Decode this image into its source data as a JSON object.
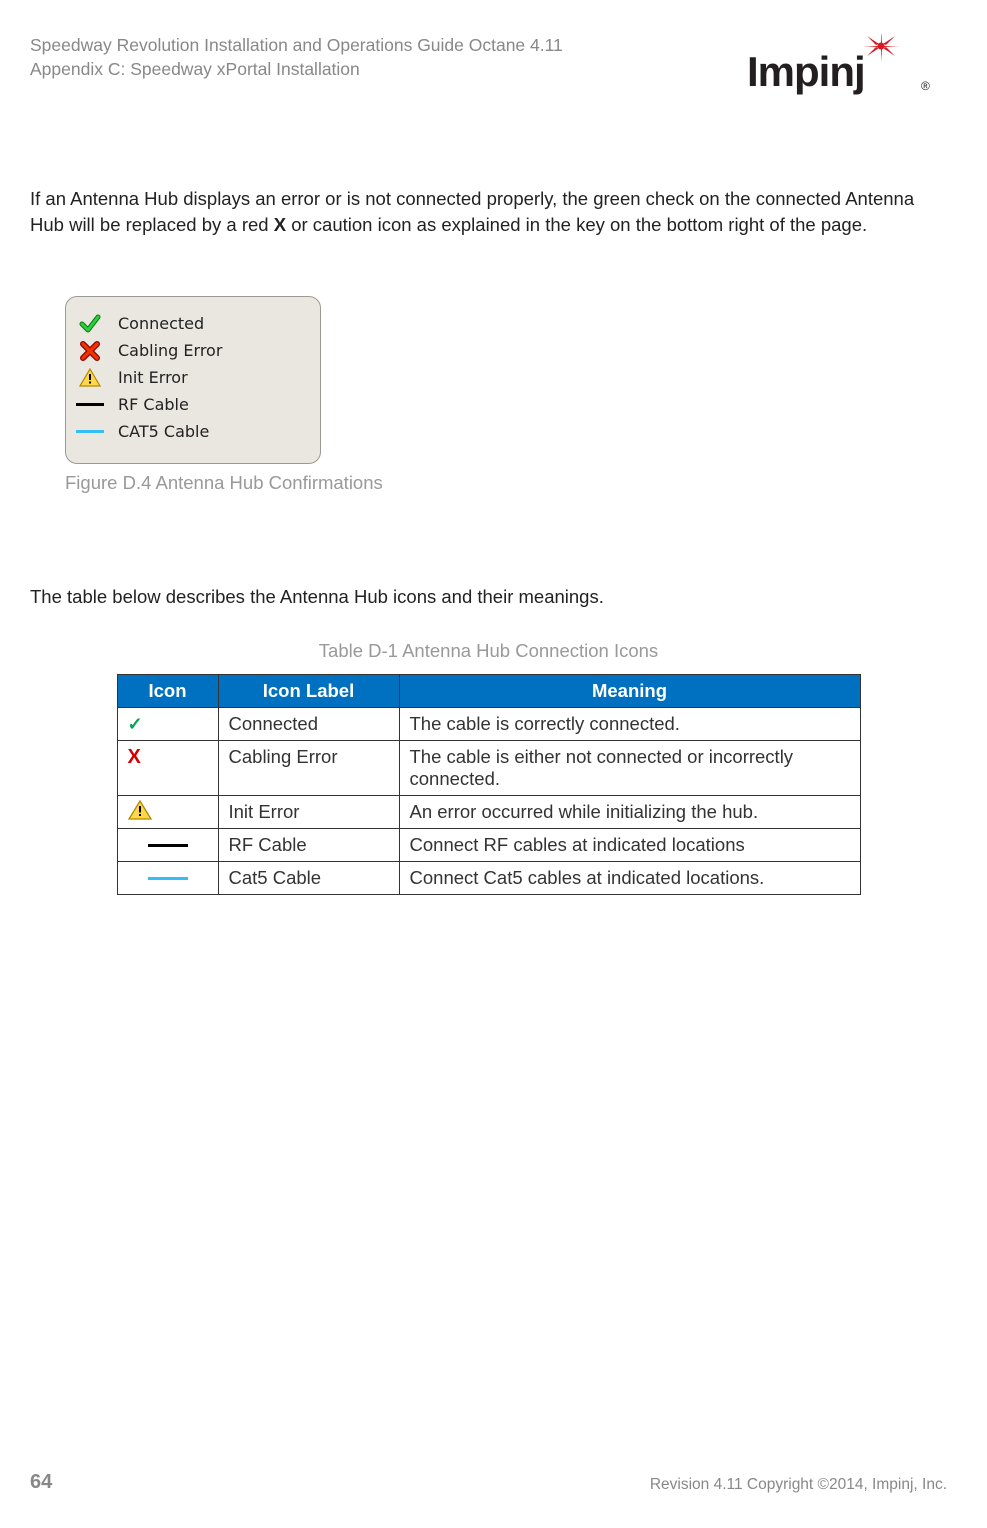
{
  "header": {
    "line1": "Speedway Revolution Installation and Operations Guide Octane 4.11",
    "line2": "Appendix C: Speedway xPortal Installation",
    "brand": "Impinj"
  },
  "para1": {
    "pre": "If an Antenna Hub displays an error or is not connected properly, the green check on the connected Antenna Hub will be replaced by a red ",
    "bold": "X",
    "post": " or caution icon as explained in the key on the bottom right of the page."
  },
  "legend": {
    "items": [
      {
        "icon": "check",
        "label": "Connected"
      },
      {
        "icon": "x",
        "label": "Cabling Error"
      },
      {
        "icon": "warn",
        "label": "Init Error"
      },
      {
        "icon": "line-black",
        "label": "RF Cable"
      },
      {
        "icon": "line-cyan",
        "label": "CAT5 Cable"
      }
    ],
    "caption": "Figure D.4 Antenna Hub Confirmations"
  },
  "para2": "The table below describes the Antenna Hub icons and their meanings.",
  "table": {
    "caption": "Table D-1 Antenna Hub Connection Icons",
    "headers": [
      "Icon",
      "Icon Label",
      "Meaning"
    ],
    "rows": [
      {
        "icon": "check",
        "label": "Connected",
        "meaning": "The cable is correctly connected."
      },
      {
        "icon": "x",
        "label": "Cabling Error",
        "meaning": "The cable is either not connected or incorrectly connected."
      },
      {
        "icon": "warn",
        "label": "Init Error",
        "meaning": "An error occurred while initializing the hub."
      },
      {
        "icon": "line-black",
        "label": "RF Cable",
        "meaning": "Connect RF cables at indicated locations"
      },
      {
        "icon": "line-cyan",
        "label": "Cat5 Cable",
        "meaning": "Connect Cat5 cables at indicated locations."
      }
    ]
  },
  "footer": {
    "page": "64",
    "copyright": "Revision 4.11 Copyright ©2014, Impinj, Inc."
  }
}
